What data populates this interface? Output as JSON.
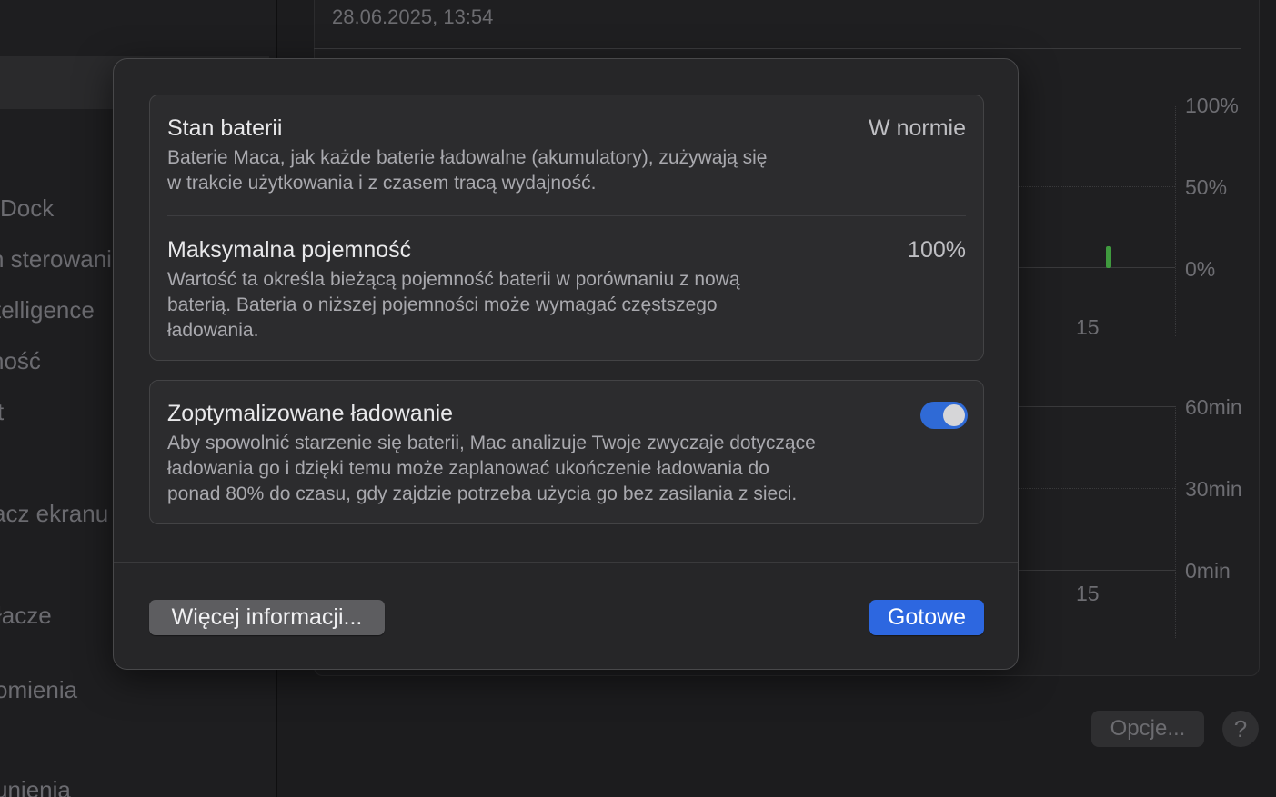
{
  "sidebar": {
    "items": [
      {
        "label": "Dock"
      },
      {
        "label": "n sterowania"
      },
      {
        "label": "telligence"
      },
      {
        "label": "ność"
      },
      {
        "label": "t"
      },
      {
        "label": "acz ekranu"
      },
      {
        "label": "łacze"
      },
      {
        "label": "omienia"
      },
      {
        "label": "unienia"
      }
    ]
  },
  "chart": {
    "date": "28.06.2025, 13:54",
    "level_axis": [
      "100%",
      "50%",
      "0%"
    ],
    "time_axis": [
      "60min",
      "30min",
      "0min"
    ],
    "x_tick_top": "15",
    "x_tick_bottom": "15"
  },
  "bottom_buttons": {
    "options": "Opcje...",
    "help": "?"
  },
  "sheet": {
    "battery_health": {
      "title": "Stan baterii",
      "value": "W normie",
      "desc_line1": "Baterie Maca, jak każde baterie ładowalne (akumulatory), zużywają się",
      "desc_line2": "w trakcie użytkowania i z czasem tracą wydajność."
    },
    "max_capacity": {
      "title": "Maksymalna pojemność",
      "value": "100%",
      "desc_line1": "Wartość ta określa bieżącą pojemność baterii w porównaniu z nową",
      "desc_line2": "baterią. Bateria o niższej pojemności może wymagać częstszego",
      "desc_line3": "ładowania."
    },
    "optimized_charging": {
      "title": "Zoptymalizowane ładowanie",
      "enabled": true,
      "desc_line1": "Aby spowolnić starzenie się baterii, Mac analizuje Twoje zwyczaje dotyczące",
      "desc_line2": "ładowania go i dzięki temu może zaplanować ukończenie ładowania do",
      "desc_line3": "ponad 80% do czasu, gdy zajdzie potrzeba użycia go bez zasilania z sieci."
    },
    "more_info_button": "Więcej informacji...",
    "done_button": "Gotowe"
  },
  "colors": {
    "accent": "#2d67e0",
    "toggle_on": "#2f6ad6",
    "chart_bar": "#3f9a3e"
  }
}
